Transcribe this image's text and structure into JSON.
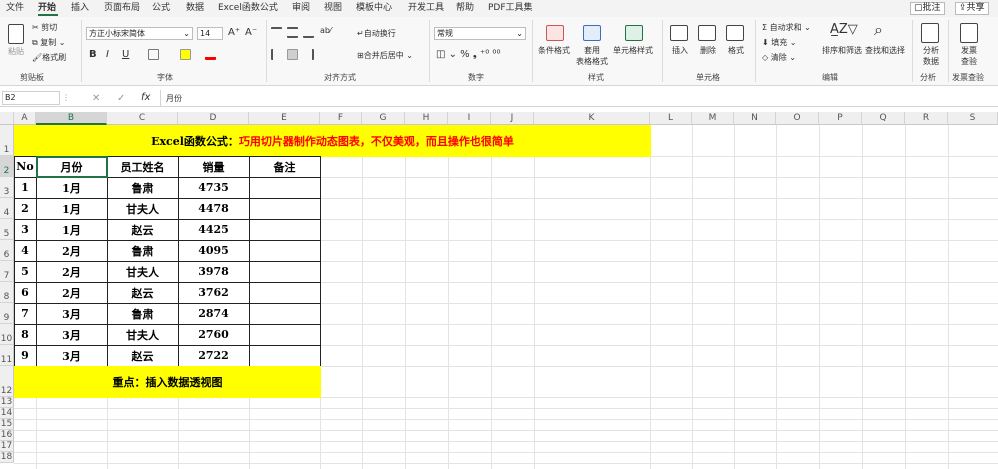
{
  "menu_tabs": [
    "文件",
    "开始",
    "插入",
    "页面布局",
    "公式",
    "数据",
    "Excel函数公式",
    "审阅",
    "视图",
    "模板中心",
    "开发工具",
    "帮助",
    "PDF工具集"
  ],
  "menu_buttons": {
    "comment": "批注",
    "share": "共享"
  },
  "ribbon": {
    "clipboard": {
      "paste": "粘贴",
      "cut": "剪切",
      "copy": "复制",
      "format_painter": "格式刷",
      "label": "剪贴板"
    },
    "font": {
      "name": "方正小标宋简体",
      "size": "14",
      "grow": "A⁺",
      "shrink": "A⁻",
      "bold": "B",
      "italic": "I",
      "underline": "U",
      "label": "字体"
    },
    "alignment": {
      "wrap": "自动换行",
      "merge": "合并后居中",
      "label": "对齐方式"
    },
    "number": {
      "format": "常规",
      "label": "数字"
    },
    "styles": {
      "cond": "条件格式",
      "table": "套用\n表格格式",
      "cell": "单元格样式",
      "label": "样式"
    },
    "cells": {
      "insert": "插入",
      "delete": "删除",
      "format": "格式",
      "label": "单元格"
    },
    "editing": {
      "autosum": "自动求和",
      "fill": "填充",
      "clear": "清除",
      "sort": "排序和筛选",
      "find": "查找和选择",
      "label": "编辑"
    },
    "analysis": {
      "btn": "分析\n数据",
      "label": "分析"
    },
    "invoice": {
      "btn": "发票\n查验",
      "label": "发票查验"
    }
  },
  "formula_bar": {
    "name_box": "B2",
    "fx": "fx",
    "content": "月份"
  },
  "columns": [
    "A",
    "B",
    "C",
    "D",
    "E",
    "F",
    "G",
    "H",
    "I",
    "J",
    "K",
    "L",
    "M",
    "N",
    "O",
    "P",
    "Q",
    "R",
    "S"
  ],
  "rows": [
    "1",
    "2",
    "3",
    "4",
    "5",
    "6",
    "7",
    "8",
    "9",
    "10",
    "11",
    "12",
    "13",
    "14",
    "15",
    "16",
    "17",
    "18"
  ],
  "title_cell": {
    "prefix": "Excel函数公式：",
    "rest": "巧用切片器制作动态图表，不仅美观，而且操作也很简单"
  },
  "table": {
    "headers": [
      "No",
      "月份",
      "员工姓名",
      "销量",
      "备注"
    ],
    "rows": [
      [
        "1",
        "1月",
        "鲁肃",
        "4735",
        ""
      ],
      [
        "2",
        "1月",
        "甘夫人",
        "4478",
        ""
      ],
      [
        "3",
        "1月",
        "赵云",
        "4425",
        ""
      ],
      [
        "4",
        "2月",
        "鲁肃",
        "4095",
        ""
      ],
      [
        "5",
        "2月",
        "甘夫人",
        "3978",
        ""
      ],
      [
        "6",
        "2月",
        "赵云",
        "3762",
        ""
      ],
      [
        "7",
        "3月",
        "鲁肃",
        "2874",
        ""
      ],
      [
        "8",
        "3月",
        "甘夫人",
        "2760",
        ""
      ],
      [
        "9",
        "3月",
        "赵云",
        "2722",
        ""
      ]
    ]
  },
  "note_cell": "重点：插入数据透视图",
  "colors": {
    "yellow": "#ffff00",
    "red": "#ff0000",
    "accent": "#217346"
  }
}
